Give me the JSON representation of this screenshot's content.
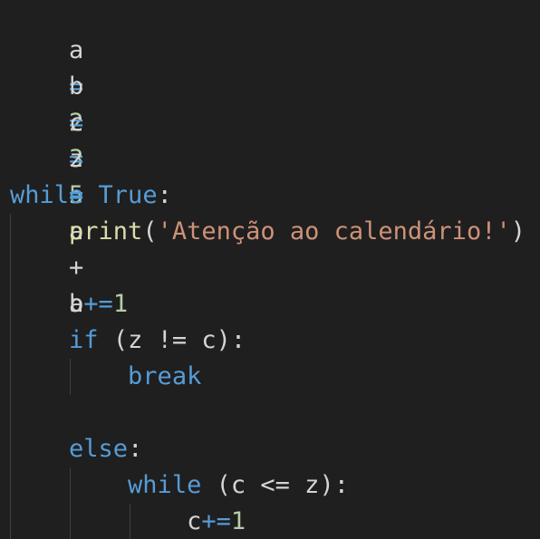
{
  "colors": {
    "background": "#1f1f1f",
    "default_text": "#d4d4d4",
    "keyword": "#569cd6",
    "number": "#b5cea8",
    "function": "#dcdcaa",
    "string": "#ce9178",
    "indent_guide": "#404040"
  },
  "code": {
    "line1": {
      "var": "a",
      "op": "=",
      "num": "2"
    },
    "line2": {
      "var": "b",
      "op": "=",
      "num": "3"
    },
    "line3": {
      "var": "c",
      "op": "=",
      "num": "5"
    },
    "line4": {
      "var": "z",
      "op": "=",
      "lhs": "a",
      "plus": "+",
      "rhs": "b"
    },
    "line6": {
      "kw": "while",
      "const": "True",
      "colon": ":"
    },
    "line7": {
      "fn": "print",
      "open": "(",
      "str": "'Atenção ao calendário!'",
      "close": ")"
    },
    "line9": {
      "var": "a",
      "op": "+=",
      "num": "1"
    },
    "line10": {
      "kw": "if",
      "open": "(",
      "lhs": "z",
      "op": "!=",
      "rhs": "c",
      "close": ")",
      "colon": ":"
    },
    "line11": {
      "kw": "break"
    },
    "line13": {
      "kw": "else",
      "colon": ":"
    },
    "line14": {
      "kw": "while",
      "open": "(",
      "lhs": "c",
      "op": "<=",
      "rhs": "z",
      "close": ")",
      "colon": ":"
    },
    "line15": {
      "var": "c",
      "op": "+=",
      "num": "1"
    }
  }
}
